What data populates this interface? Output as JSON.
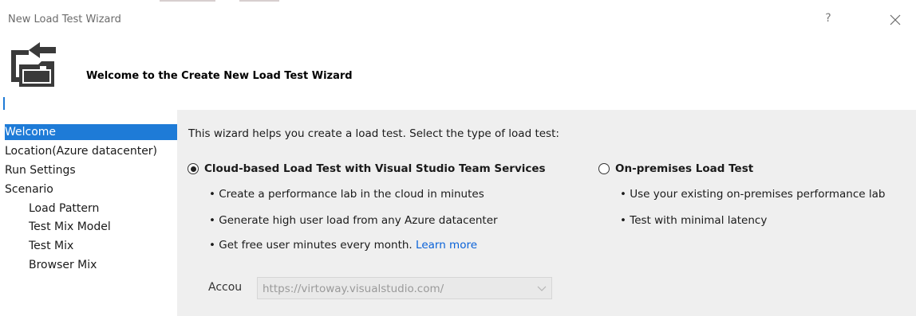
{
  "window": {
    "title": "New Load Test Wizard",
    "help": "?",
    "close_icon": "close-icon"
  },
  "banner": {
    "icon": "load-test-wizard-icon",
    "title": "Welcome to the Create New Load Test Wizard"
  },
  "nav": {
    "items": [
      {
        "label": "Welcome",
        "selected": true
      },
      {
        "label": "Location(Azure datacenter)"
      },
      {
        "label": "Run Settings"
      },
      {
        "label": "Scenario"
      },
      {
        "label": "Load Pattern",
        "indent": true
      },
      {
        "label": "Test Mix Model",
        "indent": true
      },
      {
        "label": "Test Mix",
        "indent": true
      },
      {
        "label": "Browser Mix",
        "indent": true
      }
    ]
  },
  "main": {
    "intro": "This wizard helps you create a load test. Select the type of load test:",
    "cloud": {
      "label": "Cloud-based Load Test with Visual Studio Team Services",
      "selected": true,
      "bullets": [
        "• Create a performance lab in the cloud in minutes",
        "• Generate high user load from any Azure datacenter",
        "• Get free user minutes every month."
      ],
      "learn_more": "Learn more"
    },
    "onprem": {
      "label": "On-premises Load Test",
      "selected": false,
      "bullets": [
        "• Use your existing on-premises performance lab",
        "• Test with minimal latency"
      ]
    },
    "account": {
      "label": "Accou",
      "value": "https://virtoway.visualstudio.com/",
      "enabled": false
    }
  },
  "colors": {
    "selection": "#1e7bd7",
    "link": "#0a62d8",
    "panel": "#efefef"
  }
}
